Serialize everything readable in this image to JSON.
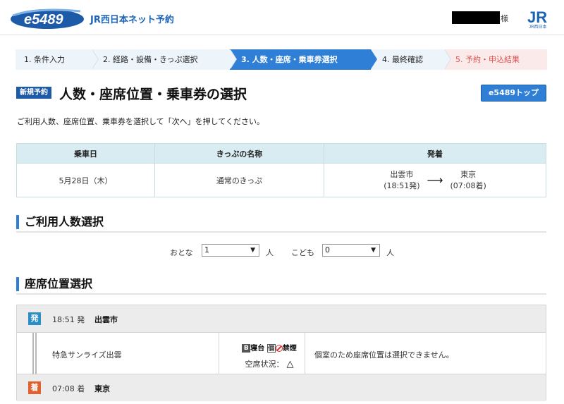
{
  "header": {
    "logo_text": "e5489",
    "site_title": "JR西日本ネット予約",
    "user_suffix": "様",
    "brand_logo_text": "JR",
    "brand_logo_sub": "JR西日本"
  },
  "steps": [
    {
      "label": "1. 条件入力"
    },
    {
      "label": "2. 経路・設備・きっぷ選択"
    },
    {
      "label": "3. 人数・座席・乗車券選択"
    },
    {
      "label": "4. 最終確認"
    },
    {
      "label": "5. 予約・申込結果"
    }
  ],
  "page": {
    "badge": "新規予約",
    "title": "人数・座席位置・乗車券の選択",
    "top_button": "e5489トップ",
    "instruction": "ご利用人数、座席位置、乗車券を選択して「次へ」を押してください。"
  },
  "trip_table": {
    "headers": [
      "乗車日",
      "きっぷの名称",
      "発着"
    ],
    "date": "5月28日（木）",
    "ticket_name": "通常のきっぷ",
    "from_station": "出雲市",
    "from_time": "(18:51発)",
    "to_station": "東京",
    "to_time": "(07:08着)",
    "arrow": "⟶"
  },
  "passengers": {
    "heading": "ご利用人数選択",
    "adult_label": "おとな",
    "adult_value": "1",
    "adult_unit": "人",
    "child_label": "こども",
    "child_value": "0",
    "child_unit": "人"
  },
  "seat": {
    "heading": "座席位置選択",
    "departure": {
      "icon": "発",
      "time": "18:51 発",
      "station": "出雲市"
    },
    "train_name": "特急サンライズ出雲",
    "facility": {
      "b_icon": "B",
      "car_type": "寝台",
      "private_icon": "個",
      "smoking": "禁煙"
    },
    "availability_label": "空席状況：",
    "availability_mark": "△",
    "note": "個室のため座席位置は選択できません。",
    "arrival": {
      "icon": "着",
      "time": "07:08 着",
      "station": "東京"
    }
  },
  "colors": {
    "accent": "#2f7fd6",
    "badge": "#1d5aa8",
    "depart_icon": "#2a8fc7",
    "arrive_icon": "#e0632f",
    "result_step": "#e0514f"
  }
}
